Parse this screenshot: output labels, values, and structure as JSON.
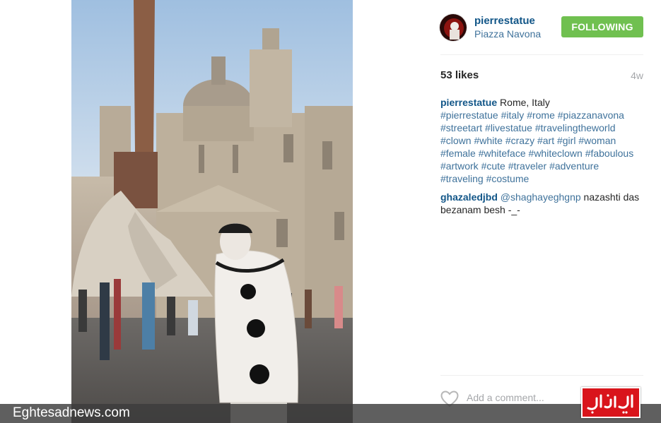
{
  "post": {
    "username": "pierrestatue",
    "location": "Piazza Navona",
    "follow_label": "FOLLOWING",
    "likes": "53 likes",
    "age": "4w"
  },
  "caption": {
    "username": "pierrestatue",
    "text": "Rome, Italy",
    "hashtags": [
      "#pierrestatue",
      "#italy",
      "#rome",
      "#piazzanavona",
      "#streetart",
      "#livestatue",
      "#travelingtheworld",
      "#clown",
      "#white",
      "#crazy",
      "#art",
      "#girl",
      "#woman",
      "#female",
      "#whiteface",
      "#whiteclown",
      "#faboulous",
      "#artwork",
      "#cute",
      "#traveler",
      "#adventure",
      "#traveling",
      "#costume"
    ]
  },
  "reply": {
    "username": "ghazaledjbd",
    "mention": "@shaghayeghgnp",
    "text": "nazashti das bezanam besh -_-"
  },
  "comment_box": {
    "placeholder": "Add a comment..."
  },
  "watermark": {
    "text": "Eghtesadnews.com",
    "logo_text": "اقتصادنیوز"
  },
  "colors": {
    "username_blue": "#125688",
    "link_blue": "#3f729b",
    "follow_green": "#70c050",
    "logo_red": "#d9141b"
  },
  "icons": [
    "heart-icon"
  ]
}
